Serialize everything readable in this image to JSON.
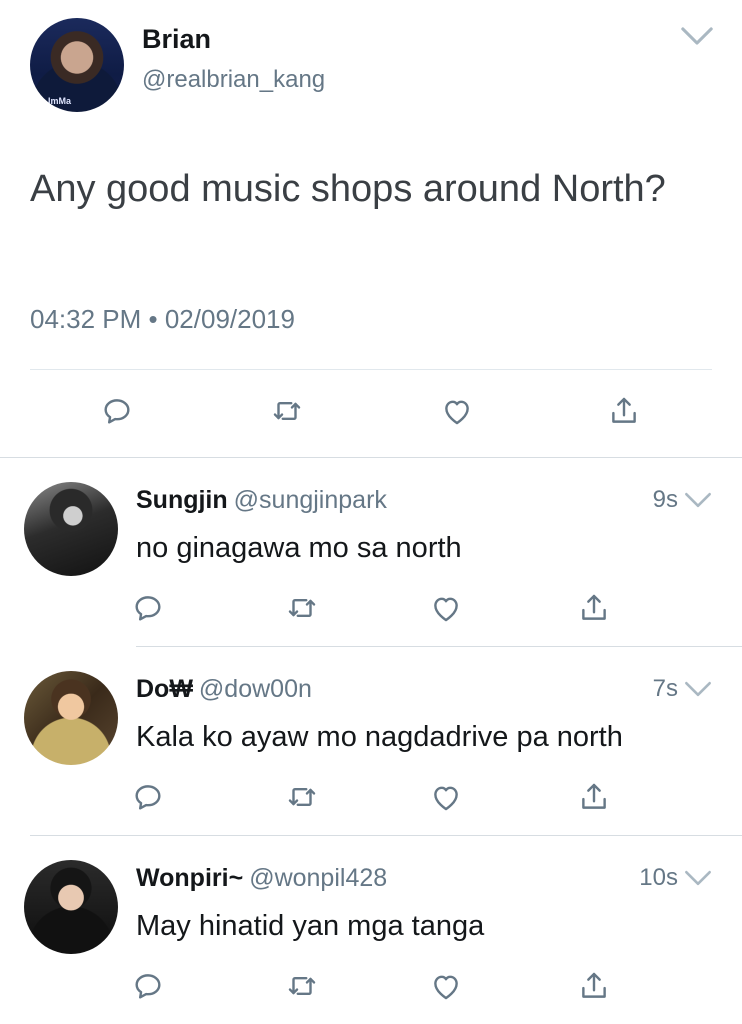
{
  "main_tweet": {
    "name": "Brian",
    "handle": "@realbrian_kang",
    "avatar_caption": "ImMa",
    "text": "Any good music shops around North?",
    "timestamp": "04:32 PM • 02/09/2019",
    "actions": [
      "reply-icon",
      "retweet-icon",
      "like-icon",
      "share-icon"
    ]
  },
  "replies": [
    {
      "name": "Sungjin",
      "handle": "@sungjinpark",
      "time": "9s",
      "text": "no ginagawa mo sa north"
    },
    {
      "name": "Do₩",
      "handle": "@dow00n",
      "time": "7s",
      "text": "Kala ko ayaw mo nagdadrive pa north"
    },
    {
      "name": "Wonpiri~",
      "handle": "@wonpil428",
      "time": "10s",
      "text": "May hinatid yan mga tanga"
    }
  ],
  "colors": {
    "text": "#14171a",
    "secondary": "#657786",
    "divider": "#e1e8ed",
    "icon": "#657786"
  }
}
